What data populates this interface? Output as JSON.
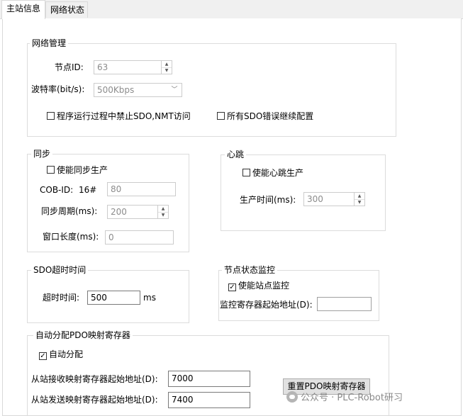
{
  "tabs": [
    {
      "label": "主站信息",
      "active": true
    },
    {
      "label": "网络状态",
      "active": false
    }
  ],
  "network": {
    "title": "网络管理",
    "node_id_label": "节点ID:",
    "node_id_value": "63",
    "baud_label": "波特率(bit/s):",
    "baud_value": "500Kbps",
    "forbid_sdo_label": "程序运行过程中禁止SDO,NMT访问",
    "forbid_sdo_checked": false,
    "sdo_continue_label": "所有SDO错误继续配置",
    "sdo_continue_checked": false
  },
  "sync": {
    "title": "同步",
    "enable_label": "使能同步生产",
    "enable_checked": false,
    "cob_label": "COB-ID:",
    "cob_prefix": "16#",
    "cob_value": "80",
    "period_label": "同步周期(ms):",
    "period_value": "200",
    "window_label": "窗口长度(ms):",
    "window_value": "0"
  },
  "heartbeat": {
    "title": "心跳",
    "enable_label": "使能心跳生产",
    "enable_checked": false,
    "time_label": "生产时间(ms):",
    "time_value": "300"
  },
  "sdo_timeout": {
    "title": "SDO超时时间",
    "label": "超时时间:",
    "value": "500",
    "unit": "ms"
  },
  "node_monitor": {
    "title": "节点状态监控",
    "enable_label": "使能站点监控",
    "enable_checked": true,
    "check_mark": "✓",
    "addr_label": "监控寄存器起始地址(D):",
    "addr_value": ""
  },
  "pdo": {
    "title": "自动分配PDO映射寄存器",
    "auto_label": "自动分配",
    "auto_checked": true,
    "check_mark": "✓",
    "rx_label": "从站接收映射寄存器起始地址(D):",
    "rx_value": "7000",
    "tx_label": "从站发送映射寄存器起始地址(D):",
    "tx_value": "7400",
    "reset_button": "重置PDO映射寄存器"
  },
  "watermark": {
    "text": "公众号 · PLC-Robot研习"
  },
  "icons": {
    "spin_up": "▲",
    "spin_down": "▼",
    "combo_arrow": "﹀"
  }
}
